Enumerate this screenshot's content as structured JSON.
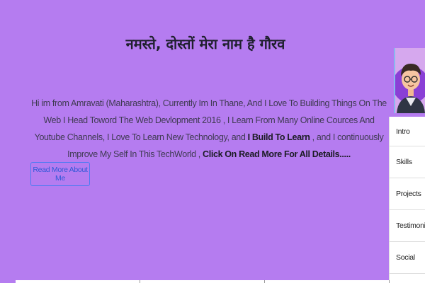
{
  "hero": {
    "title": "नमस्ते, दोस्तों मेरा नाम है गौरव",
    "intro_part1": "Hi im from Amravati (Maharashtra), Currently Im In Thane, And I Love To Building Things On The Web I Head Toword The Web Devlopment 2016 , I Learn From Many Online Cources And Youtube Channels, I Love To Learn New Technology, and ",
    "intro_bold1": "I Build To Learn",
    "intro_part2": " , and I continuously Improve My Self In This TechWorld , ",
    "intro_bold2": "Click On Read More For All Details.....",
    "read_more_label": "Read More About Me"
  },
  "side_menu": {
    "items": [
      "Intro",
      "Skills",
      "Projects",
      "Testimonials",
      "Social"
    ]
  },
  "colors": {
    "background": "#b57cf0",
    "button_border": "#4b7bf2",
    "menu_background": "#ffffff"
  }
}
